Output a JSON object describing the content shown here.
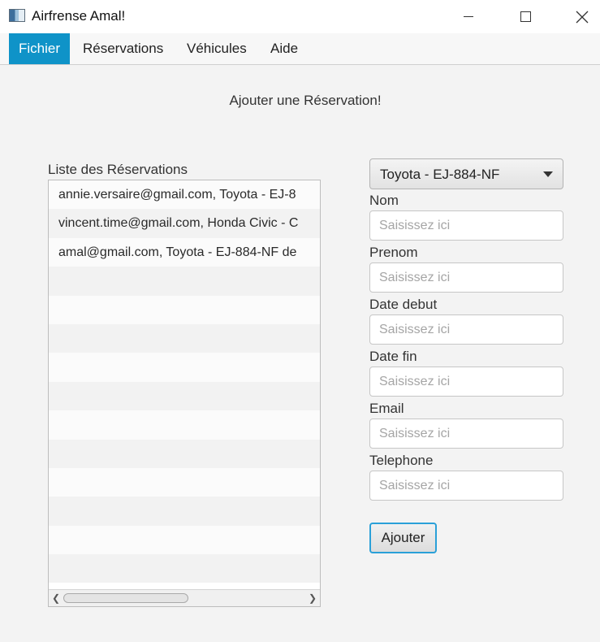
{
  "window": {
    "title": "Airfrense Amal!"
  },
  "menu": {
    "items": [
      {
        "label": "Fichier",
        "active": true
      },
      {
        "label": "Réservations",
        "active": false
      },
      {
        "label": "Véhicules",
        "active": false
      },
      {
        "label": "Aide",
        "active": false
      }
    ]
  },
  "page": {
    "title": "Ajouter une Réservation!"
  },
  "reservations": {
    "label": "Liste des Réservations",
    "items": [
      "annie.versaire@gmail.com, Toyota - EJ-8",
      "vincent.time@gmail.com, Honda Civic - C",
      "amal@gmail.com, Toyota - EJ-884-NF de"
    ],
    "empty_rows": 11
  },
  "form": {
    "vehicle": {
      "selected": "Toyota - EJ-884-NF"
    },
    "fields": [
      {
        "label": "Nom",
        "placeholder": "Saisissez ici",
        "value": ""
      },
      {
        "label": "Prenom",
        "placeholder": "Saisissez ici",
        "value": ""
      },
      {
        "label": "Date debut",
        "placeholder": "Saisissez ici",
        "value": ""
      },
      {
        "label": "Date fin",
        "placeholder": "Saisissez ici",
        "value": ""
      },
      {
        "label": "Email",
        "placeholder": "Saisissez ici",
        "value": ""
      },
      {
        "label": "Telephone",
        "placeholder": "Saisissez ici",
        "value": ""
      }
    ],
    "submit_label": "Ajouter"
  },
  "colors": {
    "accent": "#0f93c8",
    "focus": "#2aa0d8"
  },
  "icons": {
    "minimize": "minimize-icon",
    "maximize": "maximize-icon",
    "close": "close-icon",
    "dropdown": "chevron-down-icon"
  }
}
